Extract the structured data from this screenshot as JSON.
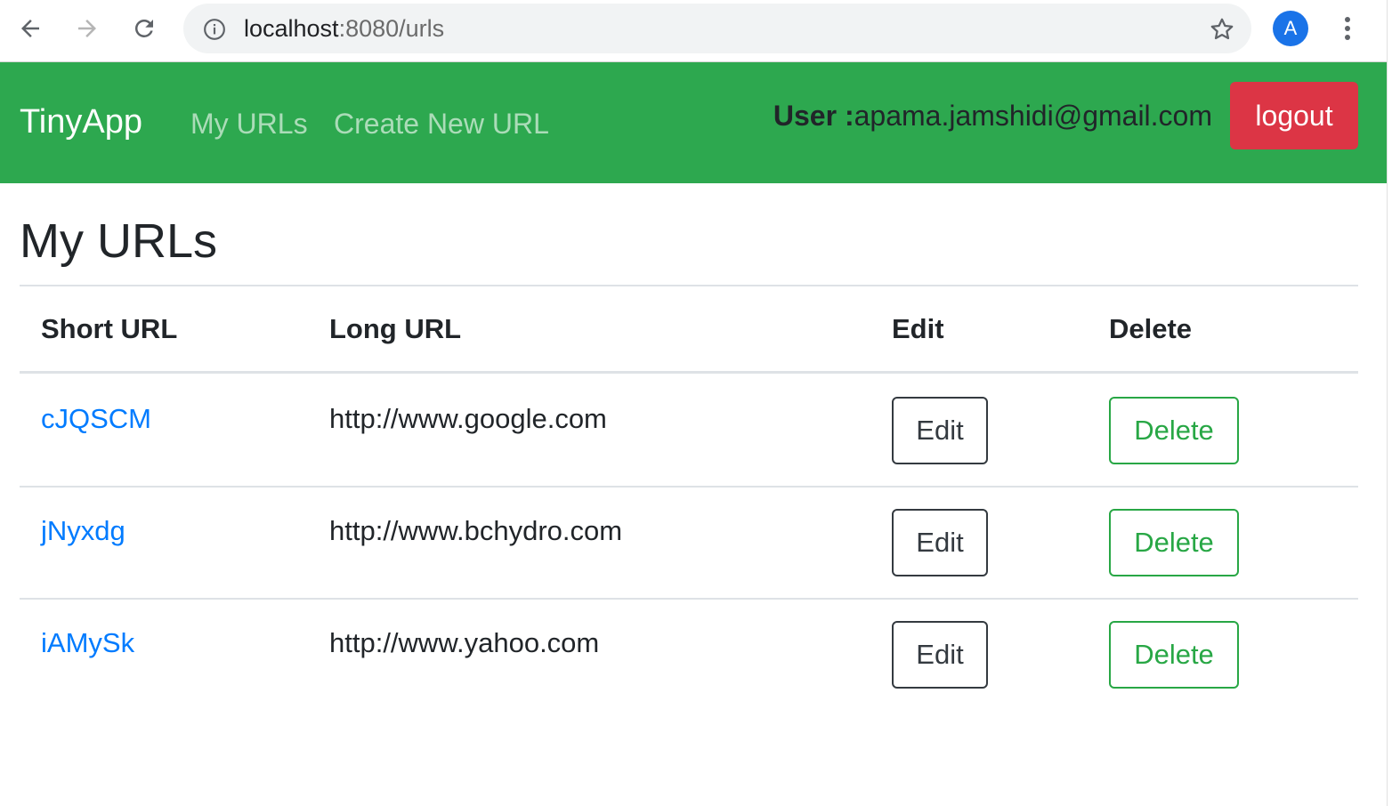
{
  "browser": {
    "url_host": "localhost",
    "url_path": ":8080/urls",
    "avatar_letter": "A"
  },
  "navbar": {
    "brand": "TinyApp",
    "links": [
      "My URLs",
      "Create New URL"
    ],
    "user_label": "User :",
    "user_email": "apama.jamshidi@gmail.com",
    "logout_label": "logout",
    "bg_color": "#2da84f",
    "logout_color": "#dc3545"
  },
  "main": {
    "title": "My URLs",
    "columns": [
      "Short URL",
      "Long URL",
      "Edit",
      "Delete"
    ],
    "rows": [
      {
        "short": "cJQSCM",
        "long": "http://www.google.com",
        "edit": "Edit",
        "delete": "Delete"
      },
      {
        "short": "jNyxdg",
        "long": "http://www.bchydro.com",
        "edit": "Edit",
        "delete": "Delete"
      },
      {
        "short": "iAMySk",
        "long": "http://www.yahoo.com",
        "edit": "Edit",
        "delete": "Delete"
      }
    ]
  }
}
